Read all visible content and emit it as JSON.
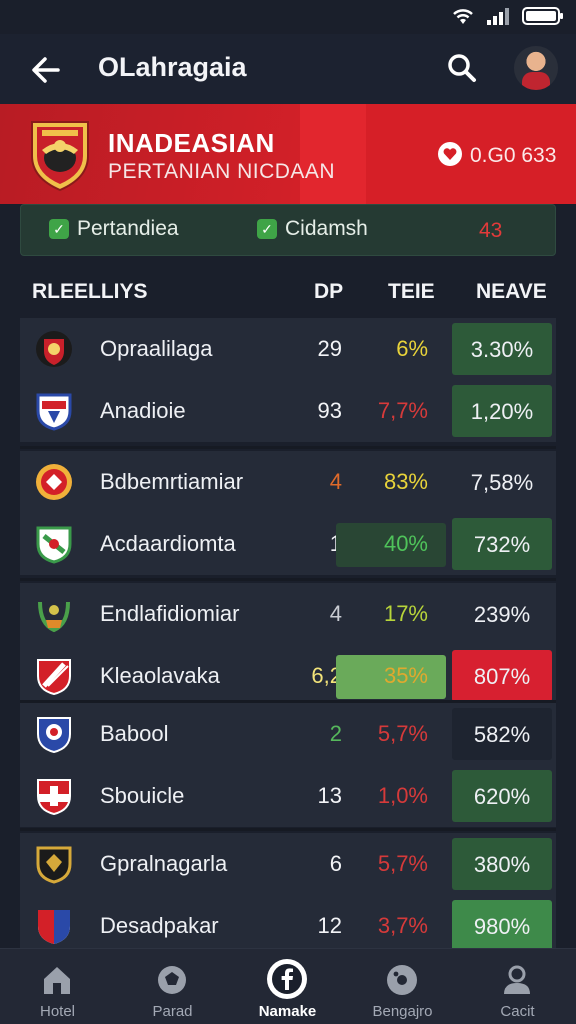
{
  "app_bar": {
    "title": "OLahragaia"
  },
  "banner": {
    "title": "INADEASIAN",
    "subtitle": "PERTANIAN NICDAAN",
    "stat": "0.G0 633",
    "accent": "#d32028"
  },
  "tabs": [
    {
      "label": "Pertandiea"
    },
    {
      "label": "Cidamsh"
    }
  ],
  "tabs_count": "43",
  "table": {
    "headers": {
      "name": "RLEELLIYS",
      "dp": "DP",
      "teie": "TEIE",
      "neave": "NEAVE"
    },
    "rows": [
      {
        "name": "Opraalilaga",
        "dp": "29",
        "teie": "6%",
        "neave": "3.30%",
        "teie_color": "#e8d33a",
        "teie_bg": "",
        "neave_bg": "#2d5a39",
        "dp_color": "#f3f4f7",
        "logo": "crest-red-black"
      },
      {
        "name": "Anadioie",
        "dp": "93",
        "teie": "7,7%",
        "neave": "1,20%",
        "teie_color": "#d63a3a",
        "teie_bg": "",
        "neave_bg": "#2d5a39",
        "dp_color": "#f3f4f7",
        "logo": "shield-red-blue"
      },
      {
        "name": "Bdbemrtiamiar",
        "dp": "4",
        "teie": "83%",
        "neave": "7,58%",
        "teie_color": "#e8d33a",
        "teie_bg": "",
        "neave_bg": "",
        "dp_color": "#e06a2a",
        "logo": "badge-orange"
      },
      {
        "name": "Acdaardiomta",
        "dp": "1",
        "teie": "40%",
        "neave": "732%",
        "teie_color": "#4fc35a",
        "teie_bg": "#294634",
        "neave_bg": "#2d5a39",
        "dp_color": "#f3f4f7",
        "logo": "shield-green-red"
      },
      {
        "name": "Endlafidiomiar",
        "dp": "4",
        "teie": "17%",
        "neave": "239%",
        "teie_color": "#b7d43a",
        "teie_bg": "",
        "neave_bg": "",
        "dp_color": "#c9ccd3",
        "logo": "laurel-green"
      },
      {
        "name": "Kleaolavaka",
        "dp": "6,2",
        "teie": "35%",
        "neave": "807%",
        "teie_color": "#e0a92e",
        "teie_bg": "#6aaa5a",
        "neave_bg": "#d72030",
        "dp_color": "#f3e47a",
        "logo": "shield-red-white"
      },
      {
        "name": "Babool",
        "dp": "2",
        "teie": "5,7%",
        "neave": "582%",
        "teie_color": "#d63a3a",
        "teie_bg": "",
        "neave_bg": "#1e2430",
        "dp_color": "#56b85c",
        "logo": "shield-blue-red"
      },
      {
        "name": "Sbouicle",
        "dp": "13",
        "teie": "1,0%",
        "neave": "620%",
        "teie_color": "#d63a3a",
        "teie_bg": "",
        "neave_bg": "#2d5a39",
        "dp_color": "#f3f4f7",
        "logo": "shield-red-white-2"
      },
      {
        "name": "Gpralnagarla",
        "dp": "6",
        "teie": "5,7%",
        "neave": "380%",
        "teie_color": "#d63a3a",
        "teie_bg": "",
        "neave_bg": "#2d5a39",
        "dp_color": "#f3f4f7",
        "logo": "shield-gold-black"
      },
      {
        "name": "Desadpakar",
        "dp": "12",
        "teie": "3,7%",
        "neave": "980%",
        "teie_color": "#d63a3a",
        "teie_bg": "",
        "neave_bg": "#3e8a4a",
        "dp_color": "#f3f4f7",
        "logo": "shield-red-blue-2"
      }
    ]
  },
  "bottom_nav": [
    {
      "label": "Hotel",
      "icon": "home-icon"
    },
    {
      "label": "Parad",
      "icon": "ball-icon"
    },
    {
      "label": "Namake",
      "icon": "facebook-icon",
      "active": true
    },
    {
      "label": "Bengajro",
      "icon": "record-icon"
    },
    {
      "label": "Cacit",
      "icon": "person-icon"
    }
  ]
}
